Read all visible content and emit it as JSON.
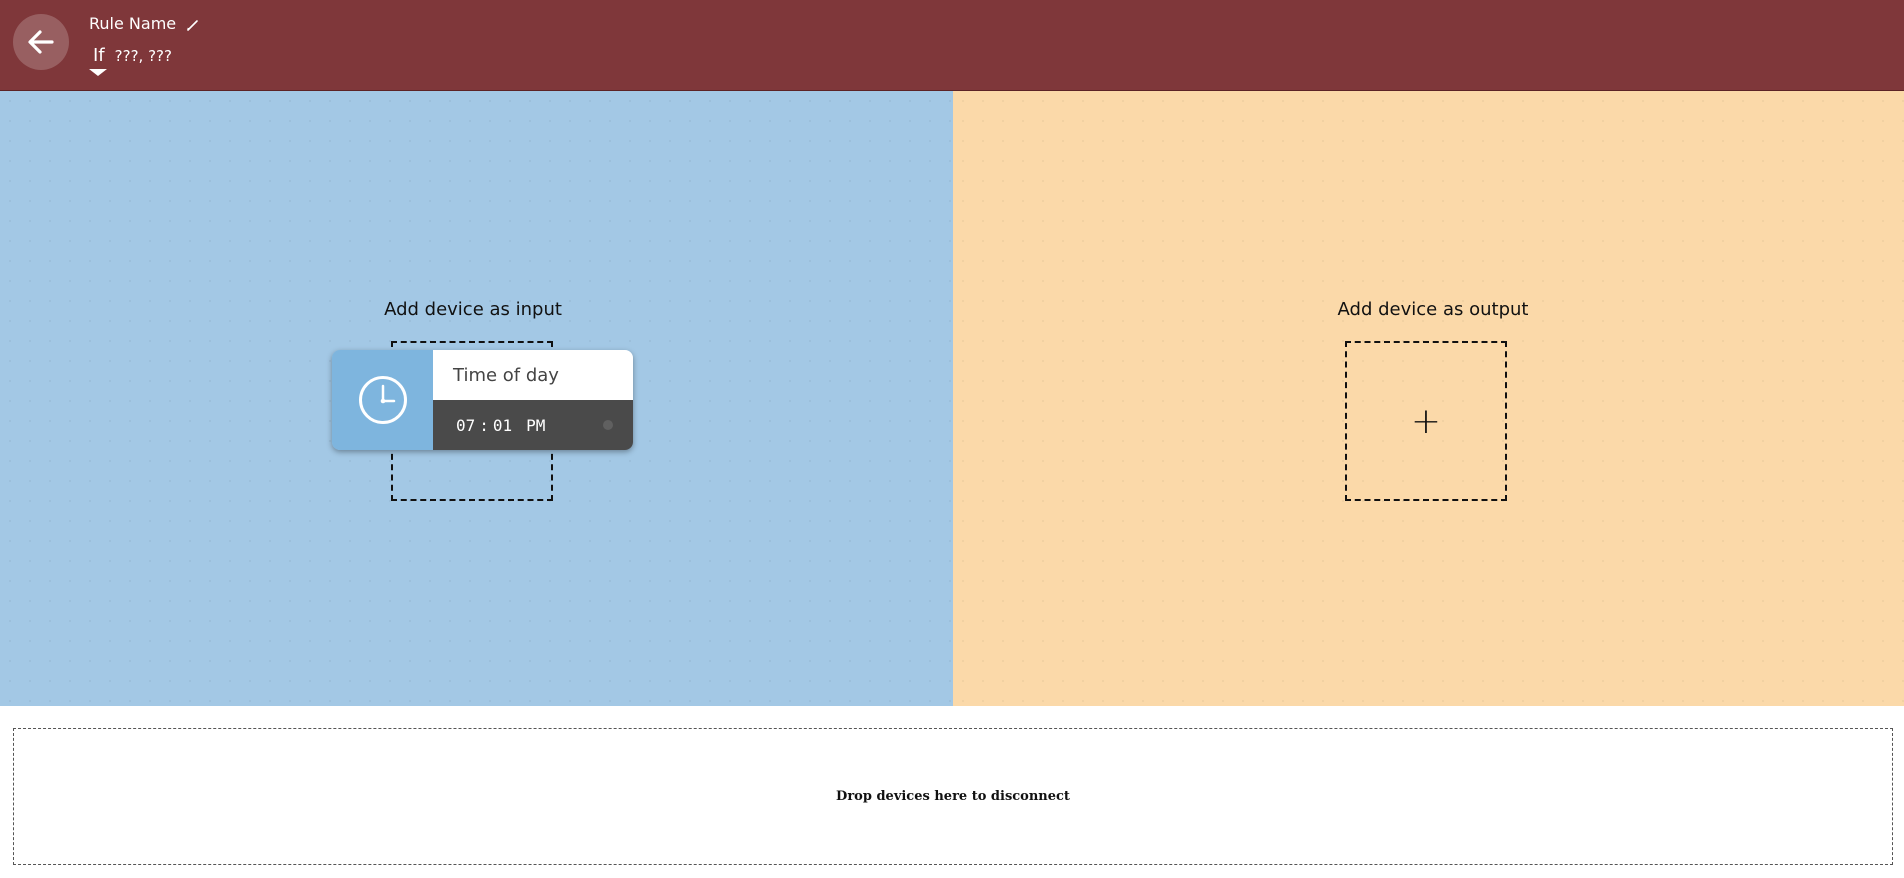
{
  "header": {
    "rule_name": "Rule Name",
    "rule_type": "If",
    "rule_description": "???, ???",
    "background_color": "#7f373a"
  },
  "input_area": {
    "label": "Add device as input",
    "background_color": "#a3c8e5",
    "device": {
      "name": "Time of day",
      "icon": "clock-icon",
      "hour": "07",
      "separator": ":",
      "minute": "01",
      "ampm": "PM",
      "icon_background": "#7eb5de"
    }
  },
  "output_area": {
    "label": "Add device as output",
    "add_symbol": "+",
    "background_color": "#fbd9a9"
  },
  "disconnect_zone": {
    "label": "Drop devices here to disconnect"
  }
}
